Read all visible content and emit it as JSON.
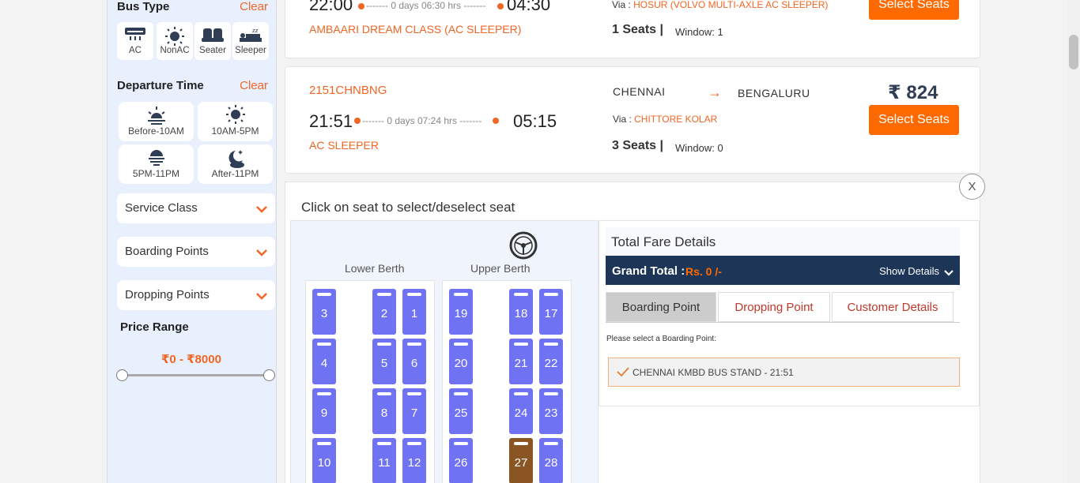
{
  "sidebar": {
    "bus_type": {
      "heading": "Bus Type",
      "clear": "Clear",
      "options": [
        {
          "label": "AC",
          "icon": "ac-icon"
        },
        {
          "label": "NonAC",
          "icon": "sun-icon"
        },
        {
          "label": "Seater",
          "icon": "seater-icon"
        },
        {
          "label": "Sleeper",
          "icon": "sleeper-icon"
        }
      ]
    },
    "departure": {
      "heading": "Departure Time",
      "clear": "Clear",
      "options": [
        {
          "label": "Before-10AM",
          "icon": "sunrise-icon"
        },
        {
          "label": "10AM-5PM",
          "icon": "sun-icon"
        },
        {
          "label": "5PM-11PM",
          "icon": "sunset-icon"
        },
        {
          "label": "After-11PM",
          "icon": "moon-icon"
        }
      ]
    },
    "service_class": "Service Class",
    "boarding_points": "Boarding Points",
    "dropping_points": "Dropping Points",
    "price_range": {
      "heading": "Price Range",
      "value": "₹0  - ₹8000"
    }
  },
  "card1": {
    "dep_time": "22:00",
    "duration": "0 days 06:30 hrs",
    "arr_time": "04:30",
    "bus_name": "AMBAARI DREAM CLASS (AC SLEEPER)",
    "via_label": "Via :",
    "via": "HOSUR (VOLVO MULTI-AXLE AC SLEEPER)",
    "seats": "1 Seats |",
    "window": "Window: 1",
    "button": "Select Seats"
  },
  "card2": {
    "code": "2151CHNBNG",
    "dep_time": "21:51",
    "duration": "0 days 07:24 hrs",
    "arr_time": "05:15",
    "bus_class": "AC SLEEPER",
    "from": "CHENNAI",
    "arrow": "→",
    "to": "BENGALURU",
    "via_label": "Via :",
    "via": "CHITTORE KOLAR",
    "seats": "3 Seats |",
    "window": "Window: 0",
    "price": "₹ 824",
    "button": "Select Seats"
  },
  "seat_panel": {
    "instruction": "Click on seat to select/deselect seat",
    "lower_label": "Lower Berth",
    "upper_label": "Upper Berth",
    "lower_seats": [
      [
        "3",
        "",
        "2",
        "1"
      ],
      [
        "4",
        "",
        "5",
        "6"
      ],
      [
        "9",
        "",
        "8",
        "7"
      ],
      [
        "10",
        "",
        "11",
        "12"
      ]
    ],
    "upper_seats": [
      [
        "19",
        "",
        "18",
        "17"
      ],
      [
        "20",
        "",
        "21",
        "22"
      ],
      [
        "25",
        "",
        "24",
        "23"
      ],
      [
        "26",
        "",
        "27",
        "28"
      ]
    ],
    "booked_seats": [
      "27"
    ],
    "colors": {
      "available": "#6f72f2",
      "booked": "#8a5522"
    }
  },
  "fare": {
    "title": "Total Fare Details",
    "grand_total_label": "Grand Total :",
    "grand_total_value": "Rs. 0 /-",
    "show_details": "Show Details",
    "tabs": [
      "Boarding Point",
      "Dropping Point",
      "Customer Details"
    ],
    "prompt": "Please select a Boarding Point:",
    "boarding_option": "CHENNAI KMBD BUS STAND - 21:51"
  },
  "close_label": "X"
}
